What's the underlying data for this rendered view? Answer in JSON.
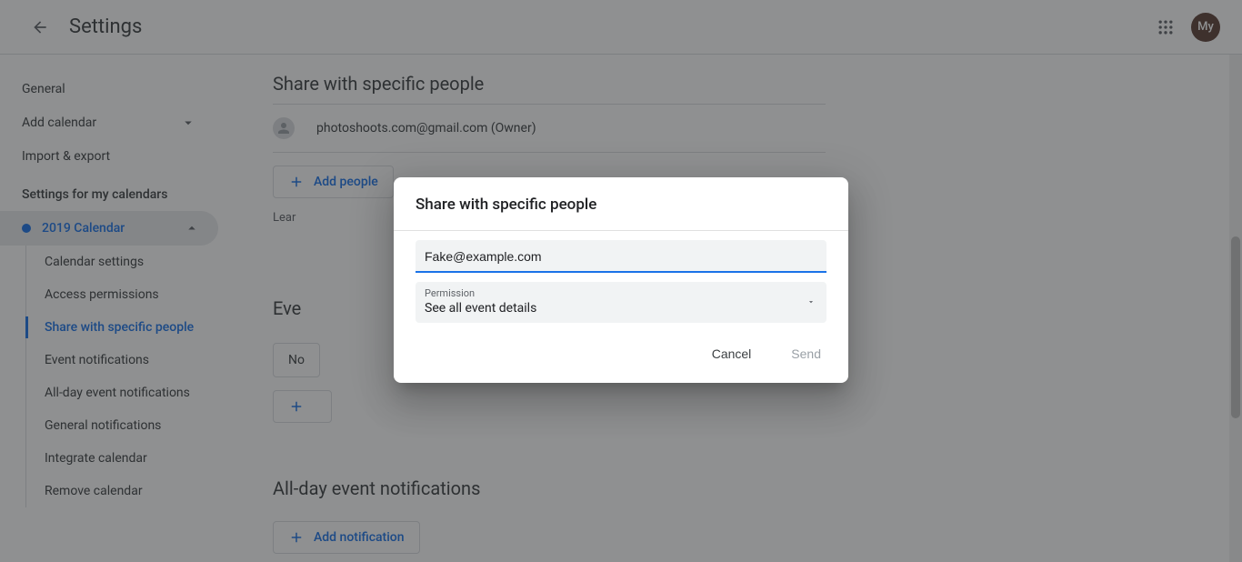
{
  "header": {
    "title": "Settings",
    "avatar": "My"
  },
  "sidebar": {
    "items": [
      {
        "label": "General"
      },
      {
        "label": "Add calendar",
        "expandable": true
      },
      {
        "label": "Import & export"
      }
    ],
    "heading": "Settings for my calendars",
    "calendar": "2019 Calendar",
    "sub": [
      "Calendar settings",
      "Access permissions",
      "Share with specific people",
      "Event notifications",
      "All-day event notifications",
      "General notifications",
      "Integrate calendar",
      "Remove calendar"
    ]
  },
  "main": {
    "share_section_title": "Share with specific people",
    "owner_row": "photoshoots.com@gmail.com (Owner)",
    "add_people_btn": "Add people",
    "learn_link": "Lear",
    "event_section_title": "Eve",
    "notif_value": "No",
    "allday_section_title": "All-day event notifications",
    "add_notification_btn": "Add notification"
  },
  "dialog": {
    "title": "Share with specific people",
    "input_value": "Fake@example.com",
    "perm_label": "Permission",
    "perm_value": "See all event details",
    "cancel": "Cancel",
    "send": "Send"
  }
}
